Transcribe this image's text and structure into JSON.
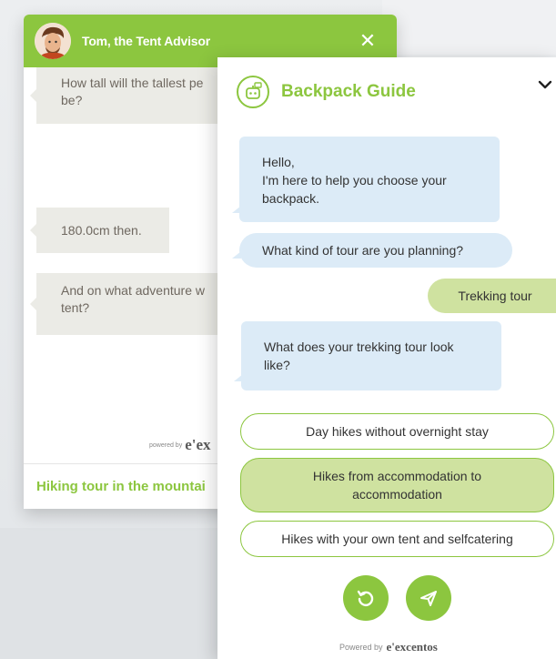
{
  "colors": {
    "accent": "#8cc63f",
    "bot_bubble": "#dcebf7",
    "user_bubble": "#cfe2a0",
    "tent_bubble": "#ebebe6"
  },
  "tent_chat": {
    "title": "Tom, the Tent Advisor",
    "close_icon": "close-icon",
    "messages": [
      {
        "text": "How tall will the tallest pe\nbe?"
      },
      {
        "text": "180.0cm then."
      },
      {
        "text": "And on what adventure w\ntent?"
      }
    ],
    "powered_label": "powered by",
    "powered_brand": "e'ex",
    "footer_text": "Hiking tour in the mountai"
  },
  "backpack_chat": {
    "title": "Backpack Guide",
    "collapse_icon": "chevron-down-icon",
    "messages": [
      {
        "from": "bot",
        "text": "Hello,\nI'm here to help you choose your backpack."
      },
      {
        "from": "bot",
        "text": "What kind of tour are you planning?"
      },
      {
        "from": "user",
        "text": "Trekking tour"
      },
      {
        "from": "bot",
        "text": "What does your trekking tour look like?"
      }
    ],
    "options": [
      {
        "label": "Day hikes without overnight stay",
        "selected": false
      },
      {
        "label": "Hikes from accommodation to accommodation",
        "selected": true
      },
      {
        "label": "Hikes with your own tent and selfcatering",
        "selected": false
      }
    ],
    "restart_icon": "restart-icon",
    "send_icon": "send-icon",
    "powered_label": "Powered by",
    "powered_brand": "e'excentos"
  }
}
